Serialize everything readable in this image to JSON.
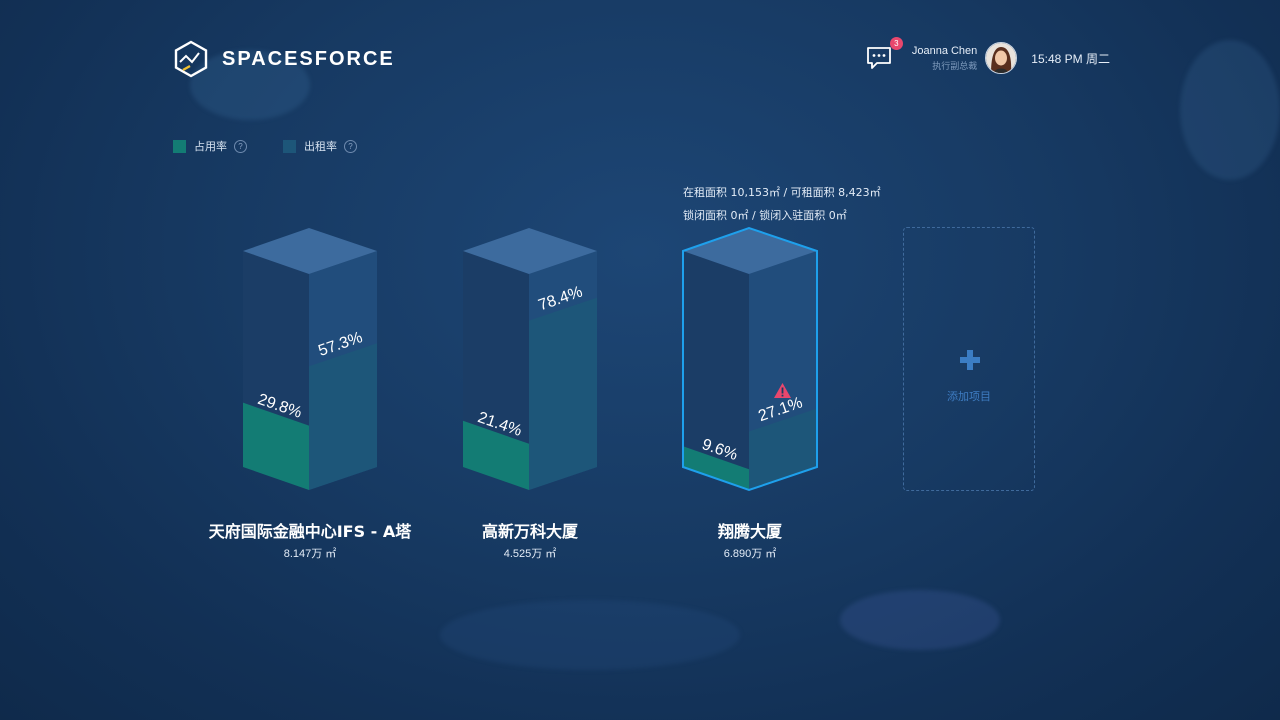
{
  "brand": {
    "name": "SPACESFORCE"
  },
  "header": {
    "message_count": "3",
    "user_name": "Joanna Chen",
    "user_title": "执行副总裁",
    "clock": "15:48 PM 周二"
  },
  "legend": [
    {
      "label": "占用率",
      "color": "#137c74",
      "help": "?"
    },
    {
      "label": "出租率",
      "color": "#1d5679",
      "help": "?"
    }
  ],
  "info": {
    "line1": "在租面积 10,153㎡ / 可租面积 8,423㎡",
    "line2": "锁闭面积 0㎡ / 锁闭入驻面积 0㎡"
  },
  "buildings": [
    {
      "name": "天府国际金融中心IFS - A塔",
      "area": "8.147万 ㎡",
      "occupancy": "29.8%",
      "rental": "57.3%",
      "occupancy_value": 29.8,
      "rental_value": 57.3,
      "selected": false
    },
    {
      "name": "高新万科大厦",
      "area": "4.525万 ㎡",
      "occupancy": "21.4%",
      "rental": "78.4%",
      "occupancy_value": 21.4,
      "rental_value": 78.4,
      "selected": false
    },
    {
      "name": "翔腾大厦",
      "area": "6.890万 ㎡",
      "occupancy": "9.6%",
      "rental": "27.1%",
      "occupancy_value": 9.6,
      "rental_value": 27.1,
      "selected": true,
      "warning": true
    }
  ],
  "add_project": {
    "label": "添加项目"
  },
  "icons": {
    "brand": "hexagon-chart-logo-icon",
    "message": "chat-bubble-icon",
    "warning": "warning-triangle-icon",
    "add": "plus-icon"
  },
  "colors": {
    "occupancy": "#137c74",
    "rental": "#1d5679",
    "top_face": "#3d6b9e",
    "selected_outline": "#1ea0ec",
    "warning": "#e8476d"
  }
}
